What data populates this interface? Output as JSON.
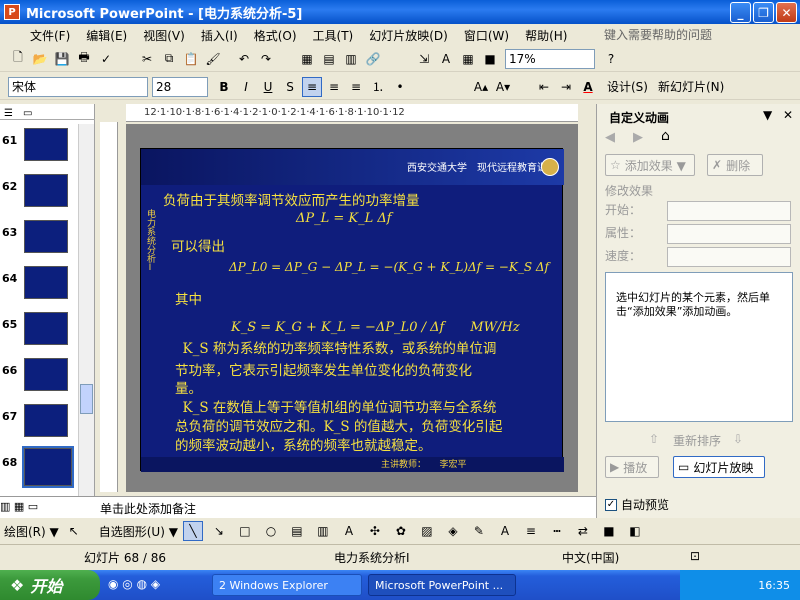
{
  "window": {
    "title": "Microsoft PowerPoint - [电力系统分析-5]",
    "min": "_",
    "max": "❐",
    "close": "✕"
  },
  "menu": [
    "文件(F)",
    "编辑(E)",
    "视图(V)",
    "插入(I)",
    "格式(O)",
    "工具(T)",
    "幻灯片放映(D)",
    "窗口(W)",
    "帮助(H)"
  ],
  "ask_placeholder": "键入需要帮助的问题",
  "toolbar": {
    "zoom": "17%",
    "font": "宋体",
    "size": "28",
    "bold": "B",
    "italic": "I",
    "underline": "U",
    "shadow": "S",
    "design": "设计(S)",
    "new_slide": "新幻灯片(N)"
  },
  "slides": [
    {
      "num": "61"
    },
    {
      "num": "62"
    },
    {
      "num": "63"
    },
    {
      "num": "64"
    },
    {
      "num": "65"
    },
    {
      "num": "66"
    },
    {
      "num": "67"
    },
    {
      "num": "68"
    }
  ],
  "slide": {
    "header": "西安交通大学　现代远程教育课程",
    "side": "电力系统分析Ⅰ",
    "line1": "负荷由于其频率调节效应而产生的功率增量",
    "eq1": "ΔP_L = K_L Δf",
    "line2": "可以得出",
    "eq2": "ΔP_L0 = ΔP_G − ΔP_L = −(K_G + K_L)Δf = −K_S Δf",
    "line3": "其中",
    "eq3": "K_S = K_G + K_L = −ΔP_L0 / Δf　　MW/Hz",
    "para1": "　K_S 称为系统的功率频率特性系数，或系统的单位调",
    "para2": "节功率，它表示引起频率发生单位变化的负荷变化",
    "para3": "量。",
    "para4": "　K_S 在数值上等于等值机组的单位调节功率与全系统",
    "para5": "总负荷的调节效应之和。K_S 的值越大，负荷变化引起",
    "para6": "的频率波动越小，系统的频率也就越稳定。",
    "footer": "主讲教师：　　李宏平"
  },
  "taskpane": {
    "title": "自定义动画",
    "add_effect": "添加效果 ▼",
    "remove": "删除",
    "modify": "修改效果",
    "start": "开始：",
    "property": "属性：",
    "speed": "速度：",
    "hint": "选中幻灯片的某个元素，然后单击“添加效果”添加动画。",
    "reorder": "重新排序",
    "play": "播放",
    "slideshow": "幻灯片放映",
    "autopreview": "自动预览"
  },
  "notes": "单击此处添加备注",
  "drawbar": {
    "draw": "绘图(R) ▼",
    "autoshape": "自选图形(U) ▼"
  },
  "status": {
    "slide": "幻灯片 68 / 86",
    "design": "电力系统分析I",
    "lang": "中文(中国)"
  },
  "taskbar": {
    "start": "开始",
    "task1": "2 Windows Explorer",
    "task2": "Microsoft PowerPoint ...",
    "time": "16:35"
  }
}
